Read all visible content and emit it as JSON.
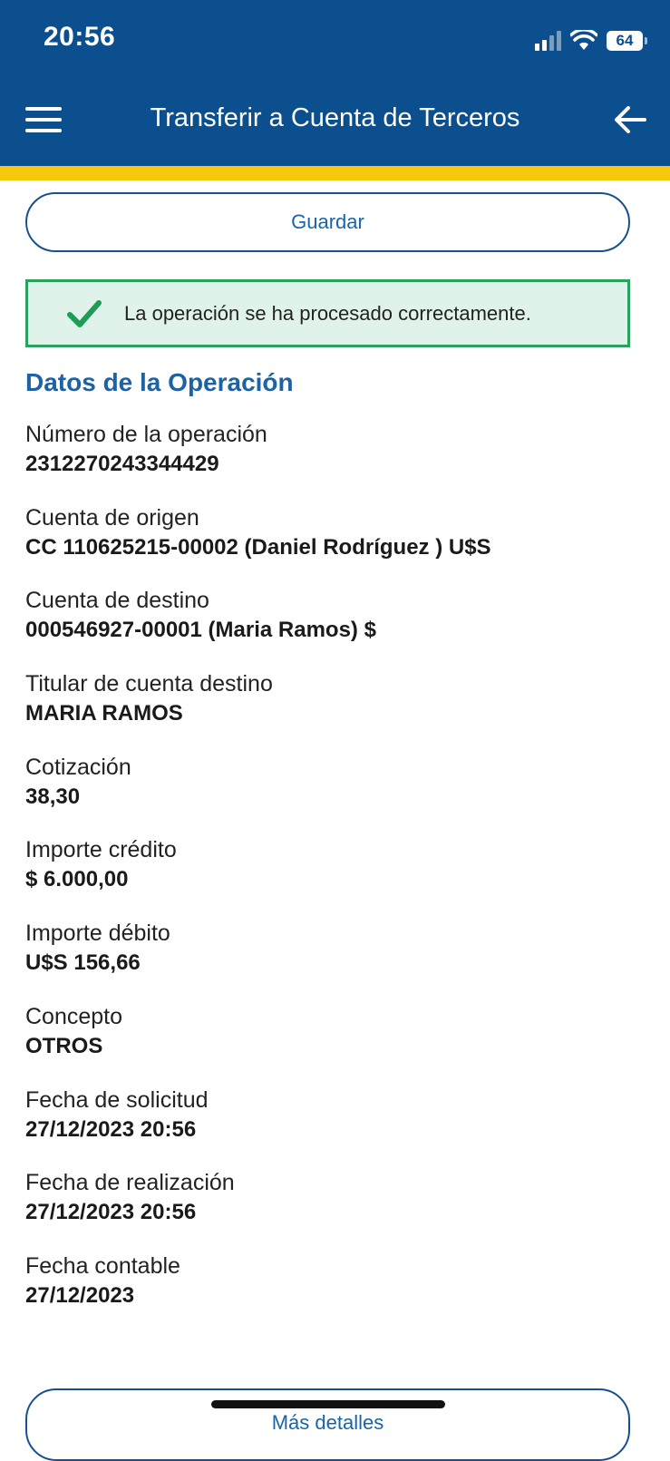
{
  "status_bar": {
    "time": "20:56",
    "battery": "64"
  },
  "header": {
    "title": "Transferir a Cuenta de Terceros"
  },
  "buttons": {
    "save": "Guardar",
    "more_details": "Más detalles"
  },
  "alert": {
    "message": "La operación se ha procesado correctamente."
  },
  "section_title": "Datos de la Operación",
  "fields": [
    {
      "label": "Número de la operación",
      "value": "2312270243344429"
    },
    {
      "label": "Cuenta de origen",
      "value": "CC 110625215-00002 (Daniel Rodríguez ) U$S"
    },
    {
      "label": "Cuenta de destino",
      "value": "000546927-00001 (Maria Ramos) $"
    },
    {
      "label": "Titular de cuenta destino",
      "value": "MARIA RAMOS"
    },
    {
      "label": "Cotización",
      "value": "38,30"
    },
    {
      "label": "Importe crédito",
      "value": "$ 6.000,00"
    },
    {
      "label": "Importe débito",
      "value": "U$S 156,66"
    },
    {
      "label": "Concepto",
      "value": "OTROS"
    },
    {
      "label": "Fecha de solicitud",
      "value": "27/12/2023 20:56"
    },
    {
      "label": "Fecha de realización",
      "value": "27/12/2023 20:56"
    },
    {
      "label": "Fecha contable",
      "value": "27/12/2023"
    }
  ],
  "colors": {
    "header_bg": "#0c4f8e",
    "accent_strip": "#f6c80d",
    "link_blue": "#1765ad",
    "success_border": "#2aa160",
    "success_bg": "#e0f3ea"
  },
  "icons": [
    "menu-icon",
    "back-arrow-icon",
    "check-icon",
    "signal-icon",
    "wifi-icon",
    "battery-icon"
  ]
}
